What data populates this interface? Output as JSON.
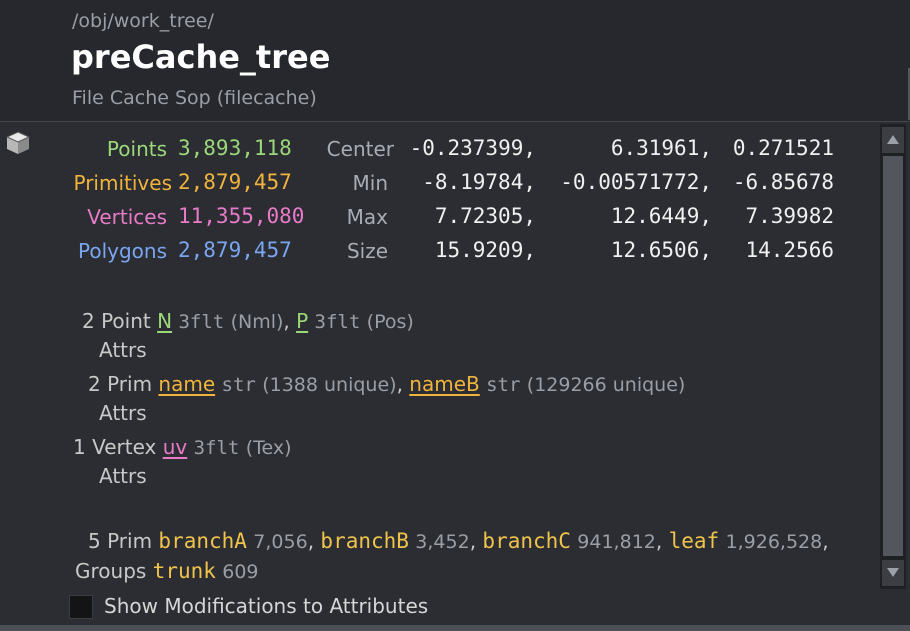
{
  "header": {
    "path": "/obj/work_tree/",
    "node_name": "preCache_tree",
    "node_type": "File Cache Sop (filecache)"
  },
  "icon": "geometry-cube-icon",
  "stats": {
    "points": {
      "label": "Points",
      "value": "3,893,118"
    },
    "primitives": {
      "label": "Primitives",
      "value": "2,879,457"
    },
    "vertices": {
      "label": "Vertices",
      "value": "11,355,080"
    },
    "polygons": {
      "label": "Polygons",
      "value": "2,879,457"
    }
  },
  "bounds": {
    "center": {
      "label": "Center",
      "x": "-0.237399,",
      "y": "6.31961,",
      "z": "0.271521"
    },
    "min": {
      "label": "Min",
      "x": "-8.19784,",
      "y": "-0.00571772,",
      "z": "-6.85678"
    },
    "max": {
      "label": "Max",
      "x": "7.72305,",
      "y": "12.6449,",
      "z": "7.39982"
    },
    "size": {
      "label": "Size",
      "x": "15.9209,",
      "y": "12.6506,",
      "z": "14.2566"
    }
  },
  "point_attrs": {
    "label_line1": "2 Point",
    "label_line2": "Attrs",
    "items": [
      {
        "name": "N",
        "type": "3flt",
        "info": "(Nml)",
        "sep": ","
      },
      {
        "name": "P",
        "type": "3flt",
        "info": "(Pos)",
        "sep": ""
      }
    ]
  },
  "prim_attrs": {
    "label_line1": "2 Prim",
    "label_line2": "Attrs",
    "items": [
      {
        "name": "name",
        "type": "str",
        "info": "(1388 unique)",
        "sep": ","
      },
      {
        "name": "nameB",
        "type": "str",
        "info": "(129266 unique)",
        "sep": ""
      }
    ]
  },
  "vertex_attrs": {
    "label_line1": "1 Vertex",
    "label_line2": "Attrs",
    "items": [
      {
        "name": "uv",
        "type": "3flt",
        "info": "(Tex)",
        "sep": ""
      }
    ]
  },
  "prim_groups": {
    "label_line1": "5 Prim",
    "label_line2": "Groups",
    "items": [
      {
        "name": "branchA",
        "count": "7,056",
        "sep": ","
      },
      {
        "name": "branchB",
        "count": "3,452",
        "sep": ","
      },
      {
        "name": "branchC",
        "count": "941,812",
        "sep": ","
      },
      {
        "name": "leaf",
        "count": "1,926,528",
        "sep": ","
      },
      {
        "name": "trunk",
        "count": "609",
        "sep": ""
      }
    ]
  },
  "checkbox": {
    "label": "Show Modifications to Attributes",
    "checked": false
  },
  "colors": {
    "points": "#9cd87a",
    "primitives": "#f0b43c",
    "vertices": "#e87bc8",
    "polygons": "#7aa6f0",
    "group_name": "#f0c44a"
  }
}
